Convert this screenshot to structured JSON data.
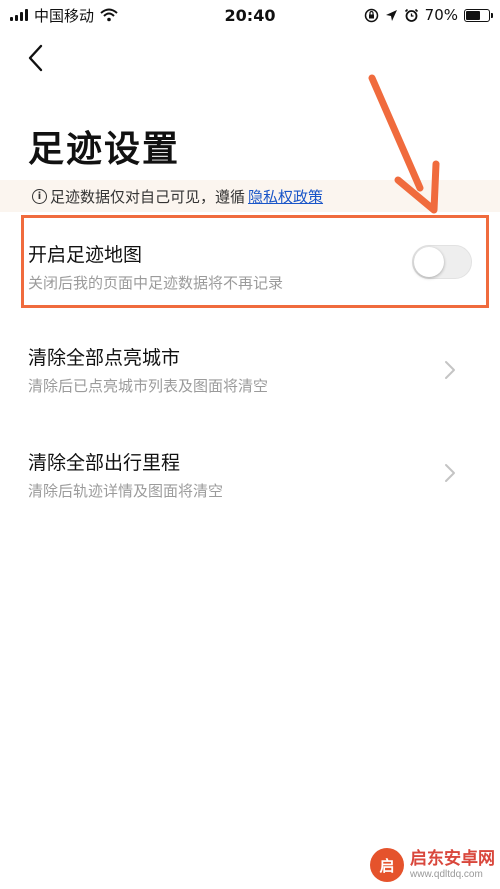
{
  "status_bar": {
    "carrier": "中国移动",
    "time": "20:40",
    "battery_percent": "70%",
    "battery_level": 0.7
  },
  "page": {
    "title": "足迹设置"
  },
  "notice": {
    "text": "足迹数据仅对自己可见，遵循",
    "link": "隐私权政策"
  },
  "settings": [
    {
      "title": "开启足迹地图",
      "subtitle": "关闭后我的页面中足迹数据将不再记录",
      "toggle_on": false
    },
    {
      "title": "清除全部点亮城市",
      "subtitle": "清除后已点亮城市列表及图面将清空"
    },
    {
      "title": "清除全部出行里程",
      "subtitle": "清除后轨迹详情及图面将清空"
    }
  ],
  "colors": {
    "annotation": "#f06b3d",
    "link": "#1a56c8",
    "notice_bg": "#fbf5ef"
  },
  "watermark": {
    "name": "启东安卓网",
    "url": "www.qdltdq.com"
  }
}
